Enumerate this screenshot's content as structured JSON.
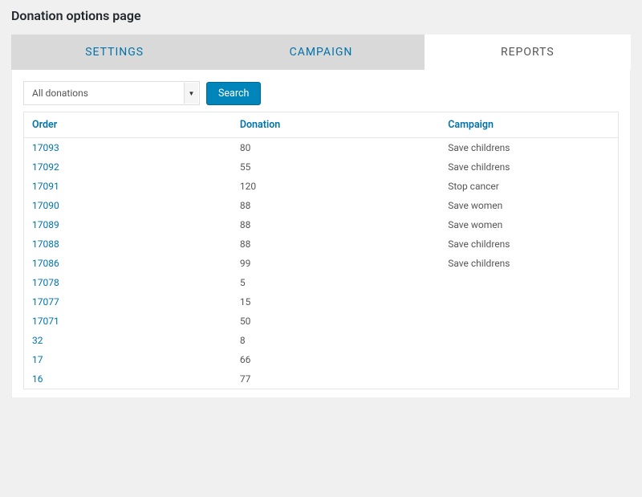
{
  "page": {
    "title": "Donation options page"
  },
  "tabs": {
    "items": [
      {
        "label": "SETTINGS",
        "active": false
      },
      {
        "label": "CAMPAIGN",
        "active": false
      },
      {
        "label": "REPORTS",
        "active": true
      }
    ]
  },
  "filter": {
    "selected": "All donations",
    "search_label": "Search"
  },
  "table": {
    "headers": {
      "order": "Order",
      "donation": "Donation",
      "campaign": "Campaign"
    },
    "rows": [
      {
        "order": "17093",
        "donation": "80",
        "campaign": "Save childrens"
      },
      {
        "order": "17092",
        "donation": "55",
        "campaign": "Save childrens"
      },
      {
        "order": "17091",
        "donation": "120",
        "campaign": "Stop cancer"
      },
      {
        "order": "17090",
        "donation": "88",
        "campaign": "Save women"
      },
      {
        "order": "17089",
        "donation": "88",
        "campaign": "Save women"
      },
      {
        "order": "17088",
        "donation": "88",
        "campaign": "Save childrens"
      },
      {
        "order": "17086",
        "donation": "99",
        "campaign": "Save childrens"
      },
      {
        "order": "17078",
        "donation": "5",
        "campaign": ""
      },
      {
        "order": "17077",
        "donation": "15",
        "campaign": ""
      },
      {
        "order": "17071",
        "donation": "50",
        "campaign": ""
      },
      {
        "order": "32",
        "donation": "8",
        "campaign": ""
      },
      {
        "order": "17",
        "donation": "66",
        "campaign": ""
      },
      {
        "order": "16",
        "donation": "77",
        "campaign": ""
      }
    ]
  }
}
